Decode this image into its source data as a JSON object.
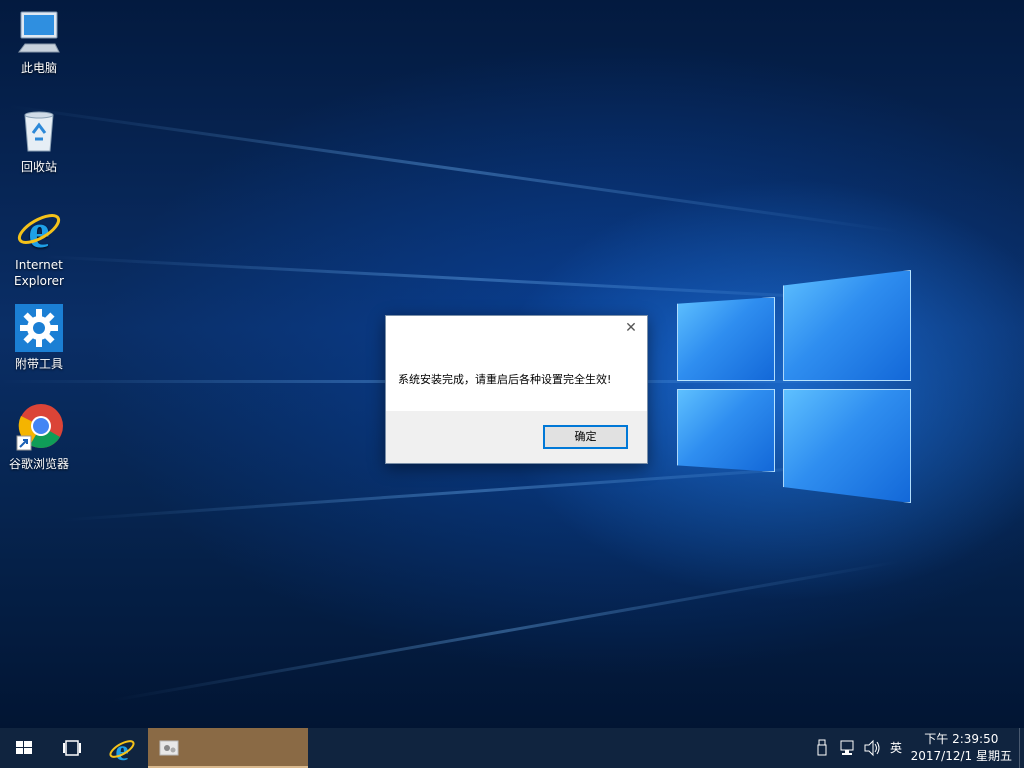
{
  "desktop": {
    "icons": [
      {
        "label": "此电脑",
        "icon": "computer-icon"
      },
      {
        "label": "回收站",
        "icon": "recycle-bin-icon"
      },
      {
        "label": "Internet Explorer",
        "icon": "internet-explorer-icon"
      },
      {
        "label": "附带工具",
        "icon": "gear-icon"
      },
      {
        "label": "谷歌浏览器",
        "icon": "chrome-icon"
      }
    ]
  },
  "dialog": {
    "message": "系统安装完成，请重启后各种设置完全生效!",
    "ok_label": "确定",
    "close_glyph": "✕"
  },
  "taskbar": {
    "start_icon": "windows-start-icon",
    "task_view_icon": "task-view-icon",
    "pinned_ie_icon": "internet-explorer-icon",
    "active_app_icon": "installer-app-icon",
    "tray": {
      "usb_icon": "usb-icon",
      "network_icon": "network-icon",
      "volume_icon": "volume-icon",
      "ime_label": "英"
    },
    "clock": {
      "time": "下午 2:39:50",
      "date": "2017/12/1 星期五"
    }
  },
  "colors": {
    "accent": "#0078d7",
    "taskbar": "#10243f",
    "active_task": "#8a6a45"
  }
}
